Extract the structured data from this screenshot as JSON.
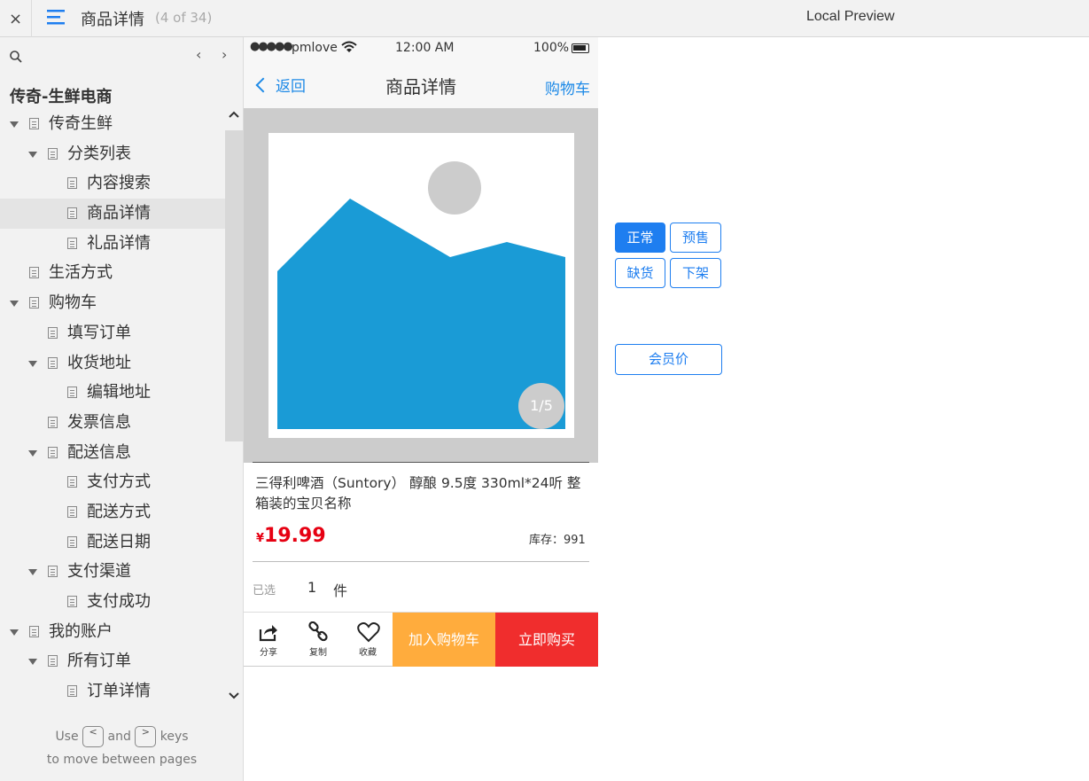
{
  "topbar": {
    "close_icon": "×",
    "title": "商品详情",
    "page_count": "(4 of 34)",
    "preview_label": "Local Preview"
  },
  "sidebar": {
    "project_name": "传奇-生鲜电商",
    "prev_icon": "‹",
    "next_icon": "›",
    "items": [
      {
        "label": "传奇生鲜",
        "level": 0,
        "expanded": true
      },
      {
        "label": "分类列表",
        "level": 1,
        "expanded": true
      },
      {
        "label": "内容搜索",
        "level": 2
      },
      {
        "label": "商品详情",
        "level": 2,
        "selected": true
      },
      {
        "label": "礼品详情",
        "level": 2
      },
      {
        "label": "生活方式",
        "level": 0
      },
      {
        "label": "购物车",
        "level": 0,
        "expanded": true
      },
      {
        "label": "填写订单",
        "level": 1
      },
      {
        "label": "收货地址",
        "level": 1,
        "expanded": true
      },
      {
        "label": "编辑地址",
        "level": 2
      },
      {
        "label": "发票信息",
        "level": 1
      },
      {
        "label": "配送信息",
        "level": 1,
        "expanded": true
      },
      {
        "label": "支付方式",
        "level": 2
      },
      {
        "label": "配送方式",
        "level": 2
      },
      {
        "label": "配送日期",
        "level": 2
      },
      {
        "label": "支付渠道",
        "level": 1,
        "expanded": true
      },
      {
        "label": "支付成功",
        "level": 2
      },
      {
        "label": "我的账户",
        "level": 0,
        "expanded": true
      },
      {
        "label": "所有订单",
        "level": 1,
        "expanded": true
      },
      {
        "label": "订单详情",
        "level": 2
      }
    ],
    "hint": {
      "use": "Use",
      "key_prev": "<",
      "and": "and",
      "key_next": ">",
      "keys": "keys",
      "line2": "to move between pages"
    }
  },
  "phone": {
    "status": {
      "signal": "●●●●●",
      "carrier": "pmlove",
      "time": "12:00 AM",
      "battery": "100%"
    },
    "nav": {
      "back": "返回",
      "title": "商品详情",
      "cart": "购物车"
    },
    "gallery": {
      "pager": "1/5",
      "image_fill": "#1a9bd6",
      "placeholder_gray": "#cccccc"
    },
    "product": {
      "name": "三得利啤酒（Suntory） 醇酿 9.5度 330ml*24听 整箱装的宝贝名称",
      "currency": "¥",
      "price": "19.99",
      "stock": "库存：991",
      "selected_label": "已选",
      "qty": "1",
      "unit": "件"
    },
    "actions": {
      "share": "分享",
      "copy": "复制",
      "favorite": "收藏",
      "add_cart": "加入购物车",
      "buy_now": "立即购买",
      "add_cart_color": "#ffac3d",
      "buy_color": "#f02d2d"
    }
  },
  "states": {
    "normal": "正常",
    "presale": "预售",
    "out_of_stock": "缺货",
    "delisted": "下架",
    "member_price": "会员价",
    "accent": "#1e7ef0"
  }
}
